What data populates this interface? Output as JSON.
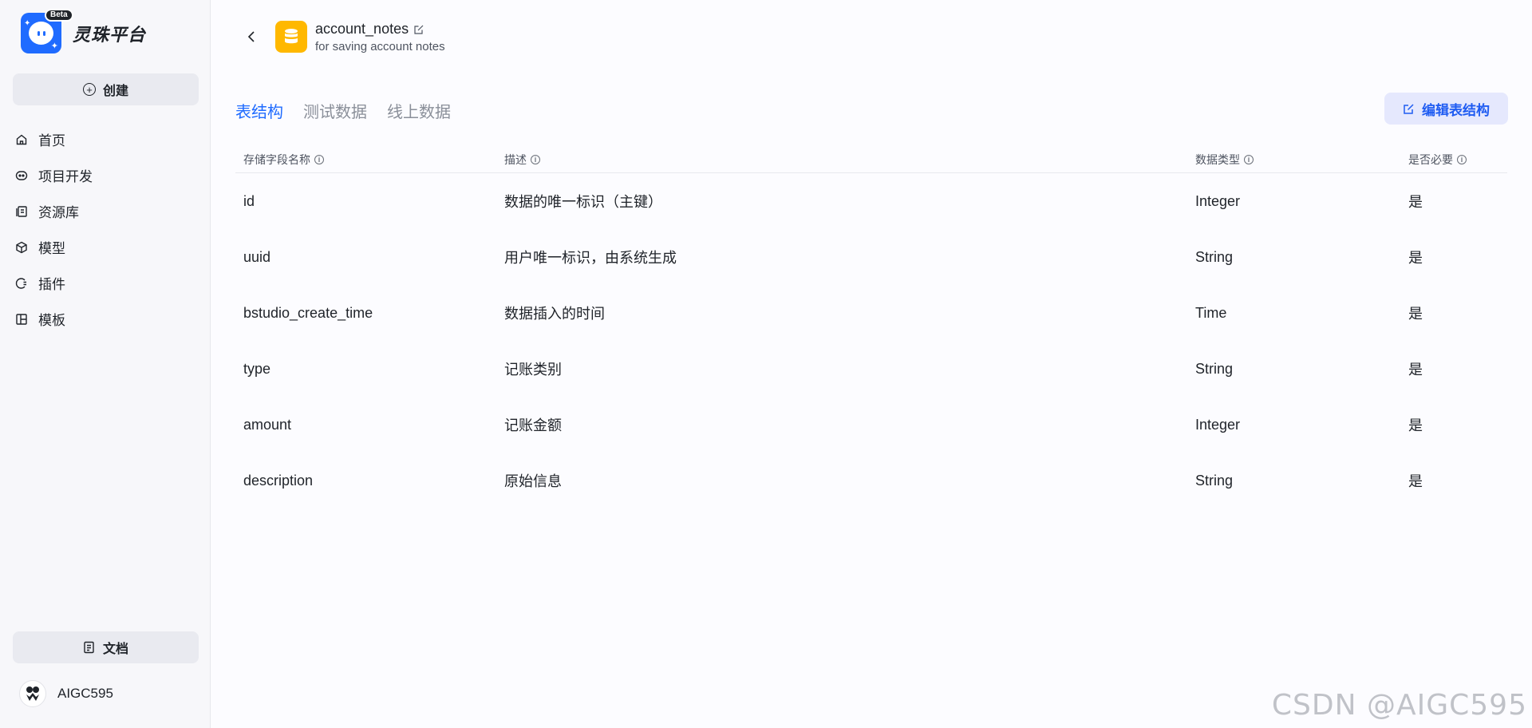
{
  "app": {
    "name": "灵珠平台",
    "badge": "Beta"
  },
  "sidebar": {
    "create_label": "创建",
    "items": [
      {
        "label": "首页",
        "icon": "home-icon"
      },
      {
        "label": "项目开发",
        "icon": "robot-icon"
      },
      {
        "label": "资源库",
        "icon": "library-icon"
      },
      {
        "label": "模型",
        "icon": "cube-icon"
      },
      {
        "label": "插件",
        "icon": "plugin-icon"
      },
      {
        "label": "模板",
        "icon": "template-icon"
      }
    ],
    "docs_label": "文档",
    "user_name": "AIGC595"
  },
  "header": {
    "table_name": "account_notes",
    "table_desc": "for saving account notes"
  },
  "tabs": [
    {
      "label": "表结构",
      "active": true
    },
    {
      "label": "测试数据",
      "active": false
    },
    {
      "label": "线上数据",
      "active": false
    }
  ],
  "edit_button_label": "编辑表结构",
  "table": {
    "columns": [
      "存储字段名称",
      "描述",
      "数据类型",
      "是否必要"
    ],
    "rows": [
      {
        "name": "id",
        "desc": "数据的唯一标识（主键）",
        "type": "Integer",
        "required": "是"
      },
      {
        "name": "uuid",
        "desc": "用户唯一标识，由系统生成",
        "type": "String",
        "required": "是"
      },
      {
        "name": "bstudio_create_time",
        "desc": "数据插入的时间",
        "type": "Time",
        "required": "是"
      },
      {
        "name": "type",
        "desc": "记账类别",
        "type": "String",
        "required": "是"
      },
      {
        "name": "amount",
        "desc": "记账金额",
        "type": "Integer",
        "required": "是"
      },
      {
        "name": "description",
        "desc": "原始信息",
        "type": "String",
        "required": "是"
      }
    ]
  },
  "watermark": "CSDN @AIGC595",
  "colors": {
    "accent": "#1f6bff",
    "db_icon": "#ffb800",
    "button_bg": "#e5e8fd"
  }
}
